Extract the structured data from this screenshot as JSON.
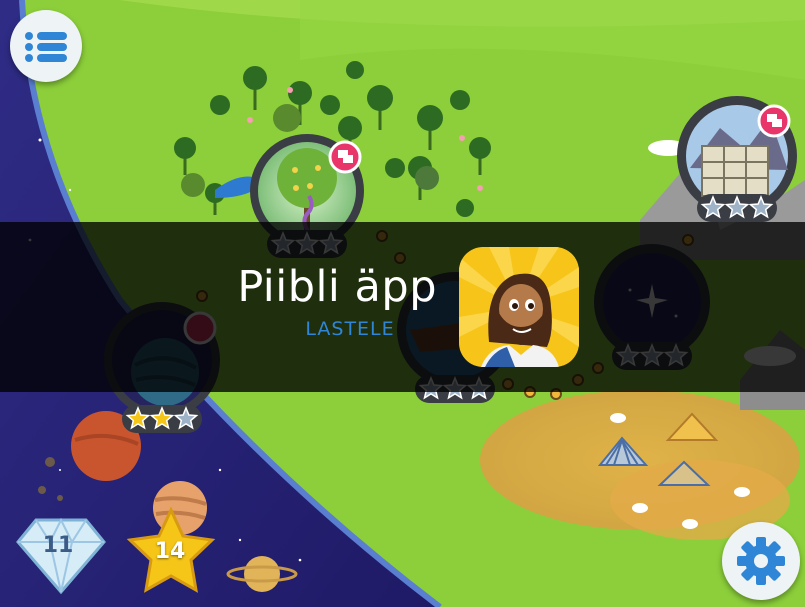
{
  "banner": {
    "title": "Piibli äpp",
    "subtitle": "LASTELE"
  },
  "counters": {
    "gems": "11",
    "stars": "14"
  },
  "levels": [
    {
      "name": "garden",
      "stars_earned": 0,
      "stars_total": 3
    },
    {
      "name": "tower",
      "stars_earned": 0,
      "stars_total": 3
    },
    {
      "name": "space",
      "stars_earned": 2,
      "stars_total": 3
    },
    {
      "name": "ark",
      "stars_earned": 0,
      "stars_total": 3
    },
    {
      "name": "night-sky",
      "stars_earned": 0,
      "stars_total": 3
    }
  ],
  "icons": {
    "menu": "menu-icon",
    "settings": "gear-icon",
    "gem": "diamond-icon",
    "star": "star-icon",
    "app": "app-logo-icon"
  },
  "colors": {
    "grass": "#8ccf3a",
    "space": "#2a2377",
    "banner_overlay": "#000000",
    "subtitle": "#2f86d6",
    "gear": "#2f86d6",
    "star_gold": "#f5c518"
  }
}
